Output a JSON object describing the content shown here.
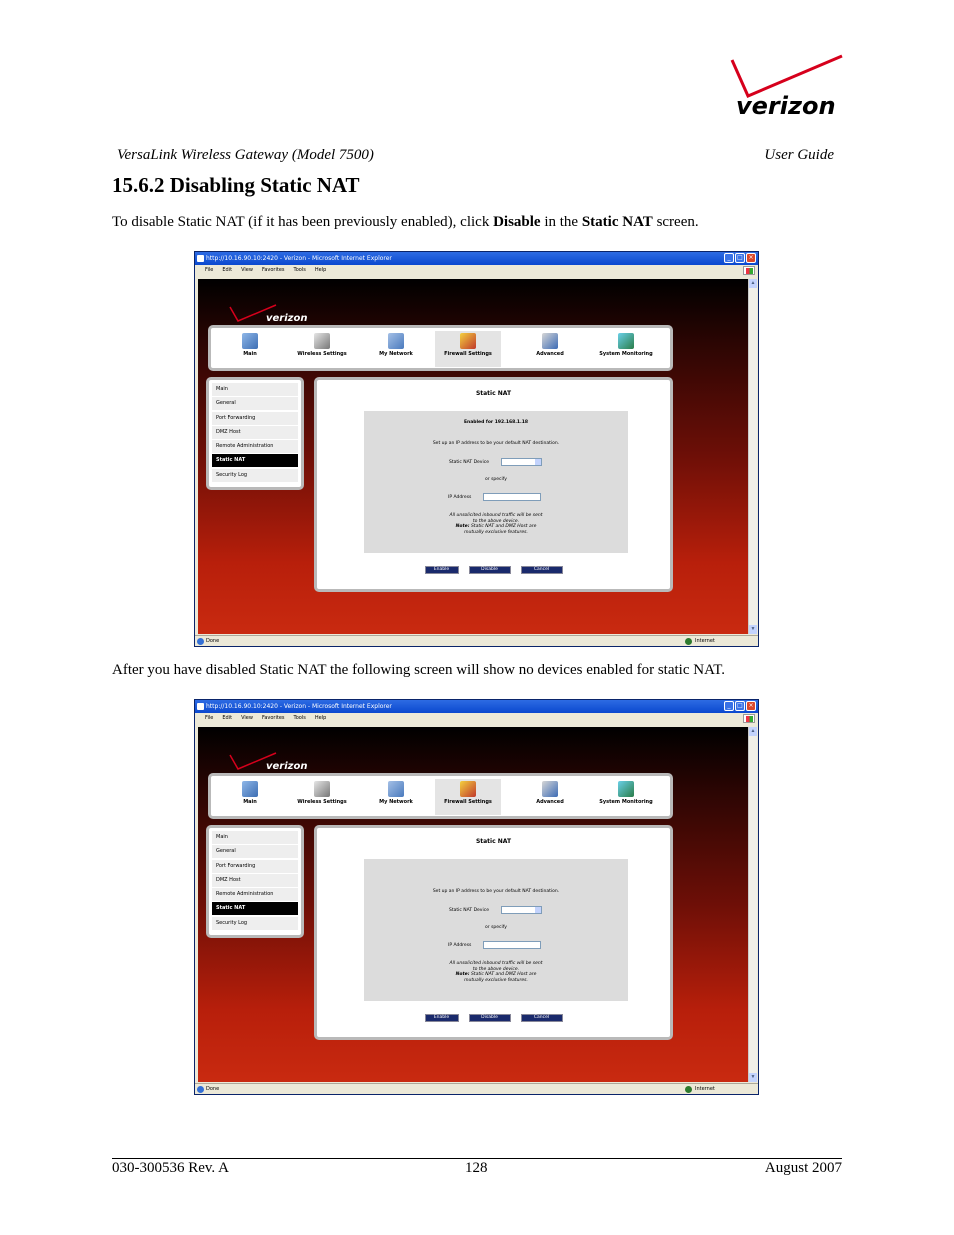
{
  "header": {
    "logo_text": "verizon",
    "doc_title": "VersaLink Wireless Gateway (Model 7500)",
    "doc_type": "User Guide"
  },
  "section": {
    "number_title": "15.6.2  Disabling Static NAT"
  },
  "paragraph1": {
    "before": "To disable Static NAT (if it has been previously enabled), click ",
    "bold1": "Disable",
    "middle": " in the ",
    "bold2": "Static NAT",
    "after": " screen."
  },
  "paragraph2": "After you have disabled Static NAT the following screen will show no devices enabled for static NAT.",
  "browser": {
    "title": "http://10.16.90.10:2420 - Verizon - Microsoft Internet Explorer",
    "menu": [
      "File",
      "Edit",
      "View",
      "Favorites",
      "Tools",
      "Help"
    ],
    "status": "Done",
    "zone": "Internet"
  },
  "router_ui": {
    "nav": [
      {
        "label": "Main",
        "icon": "main-icon"
      },
      {
        "label": "Wireless Settings",
        "icon": "wireless-icon"
      },
      {
        "label": "My Network",
        "icon": "network-icon"
      },
      {
        "label": "Firewall Settings",
        "icon": "firewall-icon"
      },
      {
        "label": "Advanced",
        "icon": "advanced-icon"
      },
      {
        "label": "System Monitoring",
        "icon": "monitoring-icon"
      }
    ],
    "side": [
      "Main",
      "General",
      "Port Forwarding",
      "DMZ Host",
      "Remote Administration",
      "Static NAT",
      "Security Log"
    ],
    "active_side": "Static NAT",
    "page_title": "Static NAT",
    "enabled_for": "Enabled for 192.168.1.18",
    "setup_text": "Set up an IP address to be your default NAT destination.",
    "device_label": "Static NAT Device",
    "or_specify": "or specify",
    "ip_label": "IP Address",
    "note_line1": "All unsolicited inbound traffic will be sent",
    "note_line2": "to the above device.",
    "note_bold": "Note:",
    "note_line3": " Static NAT and DMZ Host are",
    "note_line4": "mutually exclusive features.",
    "buttons": [
      "Enable",
      "Disable",
      "Cancel"
    ]
  },
  "footer": {
    "doc_number": "030-300536 Rev. A",
    "page": "128",
    "date": "August 2007"
  },
  "colors": {
    "brand_red": "#c8102e",
    "button_navy": "#1a2a6c"
  }
}
